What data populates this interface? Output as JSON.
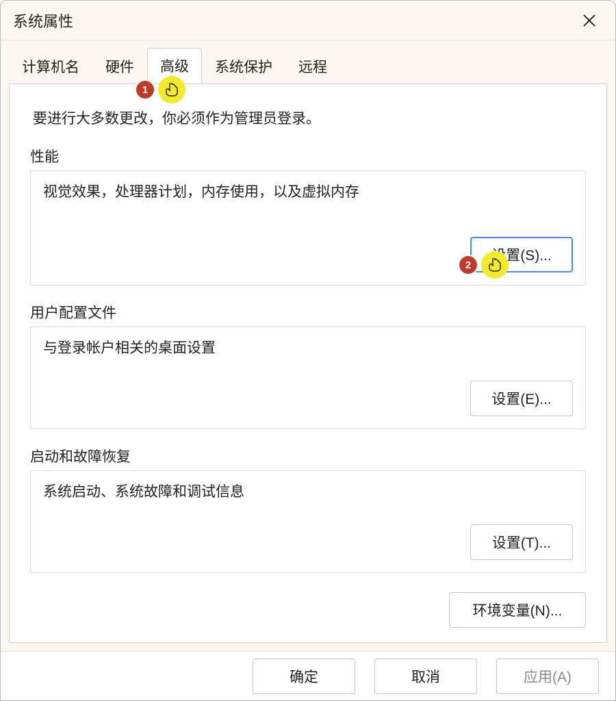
{
  "window": {
    "title": "系统属性"
  },
  "tabs": {
    "computer_name": "计算机名",
    "hardware": "硬件",
    "advanced": "高级",
    "system_protection": "系统保护",
    "remote": "远程",
    "active": "advanced"
  },
  "panel": {
    "admin_note": "要进行大多数更改，你必须作为管理员登录。",
    "performance": {
      "title": "性能",
      "desc": "视觉效果，处理器计划，内存使用，以及虚拟内存",
      "settings_btn": "设置(S)..."
    },
    "user_profiles": {
      "title": "用户配置文件",
      "desc": "与登录帐户相关的桌面设置",
      "settings_btn": "设置(E)..."
    },
    "startup_recovery": {
      "title": "启动和故障恢复",
      "desc": "系统启动、系统故障和调试信息",
      "settings_btn": "设置(T)..."
    },
    "env_vars_btn": "环境变量(N)..."
  },
  "footer": {
    "ok": "确定",
    "cancel": "取消",
    "apply": "应用(A)"
  },
  "annotations": {
    "marker1": "1",
    "marker2": "2"
  }
}
